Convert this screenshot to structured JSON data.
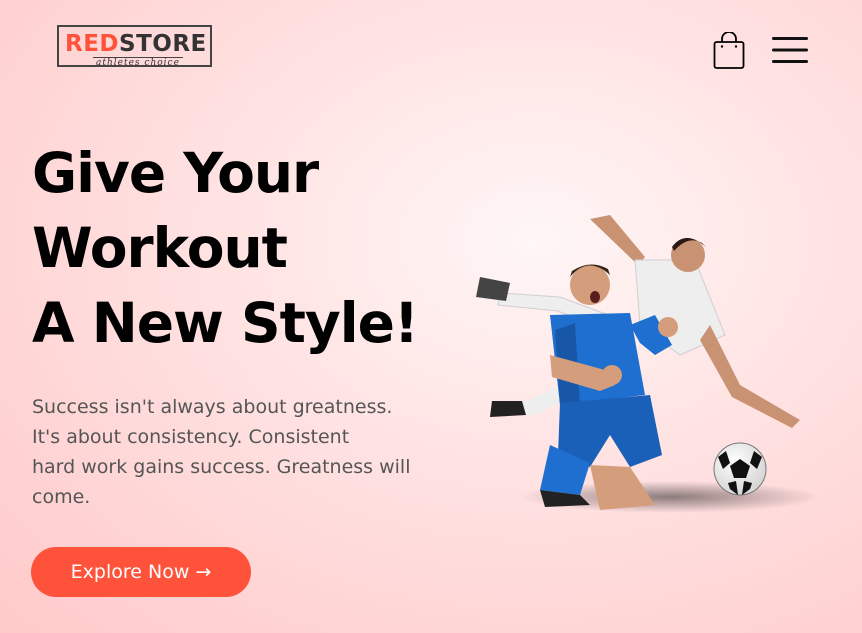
{
  "brand": {
    "logo_red": "RED",
    "logo_dark": "STORE",
    "tagline": "athletes choice",
    "accent_color": "#ff523b"
  },
  "nav": {
    "cart_icon": "shopping-bag-icon",
    "menu_icon": "hamburger-menu-icon"
  },
  "hero": {
    "title_lines": [
      "Give Your",
      "Workout",
      "A New Style!"
    ],
    "text_lines": [
      "Success isn't always about greatness.",
      "It's about consistency. Consistent",
      "hard work gains success. Greatness will",
      "come."
    ],
    "cta_label": "Explore Now →",
    "image_subject": "two soccer players celebrating and sliding with a football"
  }
}
